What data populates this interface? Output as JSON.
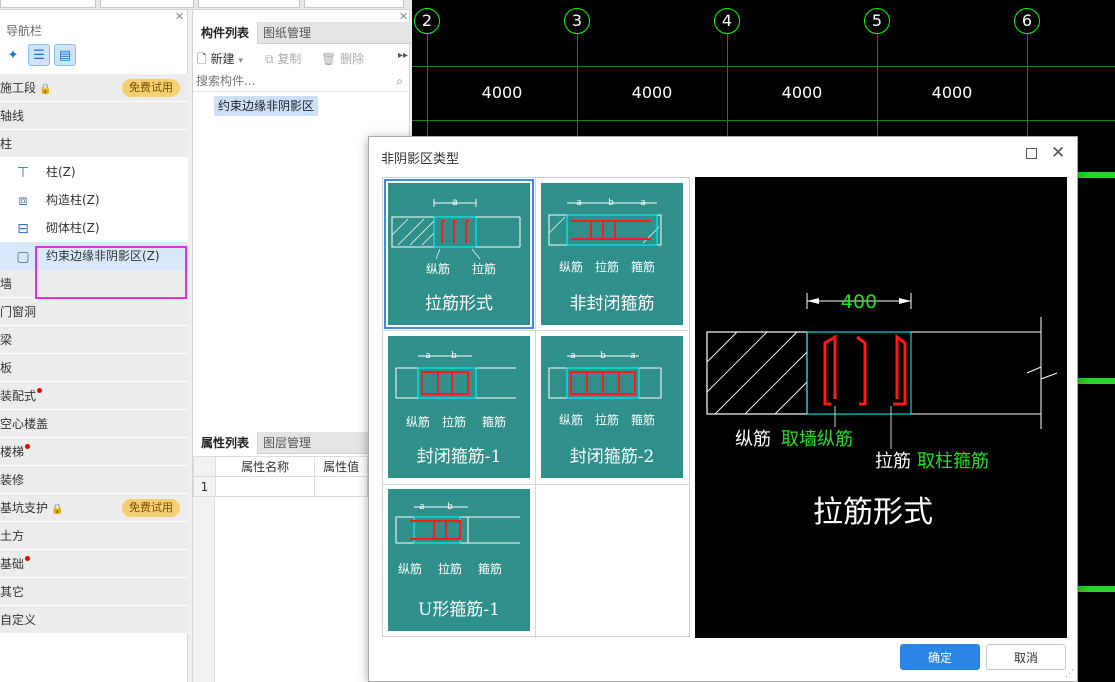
{
  "nav": {
    "title": "导航栏",
    "items": [
      {
        "label": "施工段",
        "type": "cat",
        "lock": true,
        "badge": "免费试用"
      },
      {
        "label": "轴线",
        "type": "cat"
      },
      {
        "label": "柱",
        "type": "cat"
      },
      {
        "label": "柱(Z)",
        "type": "sub",
        "icon": "column-icon"
      },
      {
        "label": "构造柱(Z)",
        "type": "sub",
        "icon": "structural-column-icon"
      },
      {
        "label": "砌体柱(Z)",
        "type": "sub",
        "icon": "masonry-column-icon"
      },
      {
        "label": "约束边缘非阴影区(Z)",
        "type": "sub",
        "icon": "edge-zone-icon",
        "selected": true
      },
      {
        "label": "墙",
        "type": "cat"
      },
      {
        "label": "门窗洞",
        "type": "cat"
      },
      {
        "label": "梁",
        "type": "cat"
      },
      {
        "label": "板",
        "type": "cat"
      },
      {
        "label": "装配式",
        "type": "cat",
        "dot": true
      },
      {
        "label": "空心楼盖",
        "type": "cat"
      },
      {
        "label": "楼梯",
        "type": "cat",
        "dot": true
      },
      {
        "label": "装修",
        "type": "cat"
      },
      {
        "label": "基坑支护",
        "type": "cat",
        "lock": true,
        "badge": "免费试用"
      },
      {
        "label": "土方",
        "type": "cat"
      },
      {
        "label": "基础",
        "type": "cat",
        "dot": true
      },
      {
        "label": "其它",
        "type": "cat"
      },
      {
        "label": "自定义",
        "type": "cat"
      }
    ]
  },
  "components": {
    "tabs": [
      "构件列表",
      "图纸管理"
    ],
    "toolbar": {
      "new": "新建",
      "copy": "复制",
      "delete": "删除"
    },
    "search_placeholder": "搜索构件...",
    "items": [
      "约束边缘非阴影区"
    ]
  },
  "properties": {
    "tabs": [
      "属性列表",
      "图层管理"
    ],
    "columns": [
      "属性名称",
      "属性值"
    ],
    "rows": [
      [
        "1",
        "",
        ""
      ]
    ]
  },
  "cad": {
    "axes": [
      "2",
      "3",
      "4",
      "5",
      "6"
    ],
    "spans": [
      "4000",
      "4000",
      "4000",
      "4000"
    ]
  },
  "dialog": {
    "title": "非阴影区类型",
    "options": [
      {
        "label": "拉筋形式",
        "selected": true,
        "sub": [
          "纵筋",
          "拉筋"
        ],
        "dims": "a"
      },
      {
        "label": "非封闭箍筋",
        "sub": [
          "纵筋",
          "拉筋",
          "箍筋"
        ],
        "dims": "a b a"
      },
      {
        "label": "封闭箍筋-1",
        "sub": [
          "纵筋",
          "拉筋",
          "箍筋"
        ],
        "dims": "a b"
      },
      {
        "label": "封闭箍筋-2",
        "sub": [
          "纵筋",
          "拉筋",
          "箍筋"
        ],
        "dims": "a b a"
      },
      {
        "label": "U形箍筋-1",
        "sub": [
          "纵筋",
          "拉筋",
          "箍筋"
        ],
        "dims": "a b"
      }
    ],
    "preview": {
      "dimension": "400",
      "note1_white": "纵筋",
      "note1_green": "取墙纵筋",
      "note2_white": "拉筋",
      "note2_green": "取柱箍筋",
      "caption": "拉筋形式"
    },
    "ok": "确定",
    "cancel": "取消"
  },
  "colors": {
    "accent": "#2b85e4",
    "thumb_bg": "#2f8f8b",
    "highlight": "#e62ce6",
    "cad_green": "#00ff00",
    "rebar_red": "#ff1a1a"
  }
}
